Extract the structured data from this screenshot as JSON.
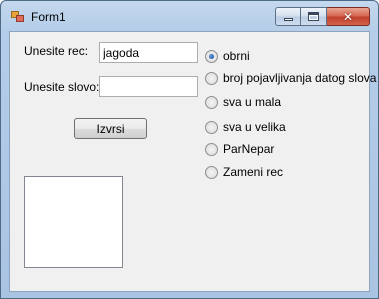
{
  "window": {
    "title": "Form1"
  },
  "form": {
    "word_label": "Unesite rec:",
    "word_value": "jagoda",
    "letter_label": "Unesite slovo:",
    "letter_value": "",
    "execute_button": "Izvrsi"
  },
  "options": {
    "selected": "obrni",
    "items": [
      {
        "label": "obrni",
        "checked": true
      },
      {
        "label": "broj pojavljivanja datog slova",
        "checked": false
      },
      {
        "label": "sva u mala",
        "checked": false
      },
      {
        "label": "sva u velika",
        "checked": false
      },
      {
        "label": "ParNepar",
        "checked": false
      },
      {
        "label": "Zameni rec",
        "checked": false
      }
    ]
  },
  "result_list": {
    "items": []
  }
}
